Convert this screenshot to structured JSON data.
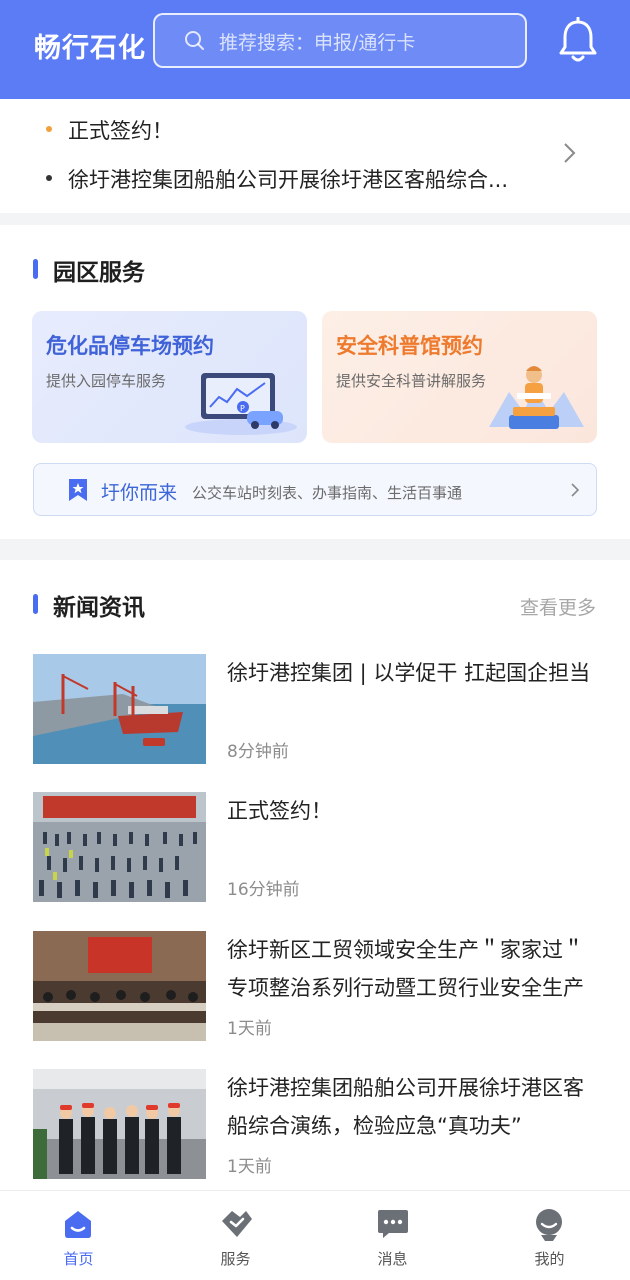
{
  "header": {
    "app_title": "畅行石化",
    "search_placeholder": "推荐搜索：申报/通行卡"
  },
  "ticker": {
    "items": [
      {
        "text": "正式签约！",
        "dot_color": "#f2a03d"
      },
      {
        "text": "徐圩港控集团船舶公司开展徐圩港区客船综合...",
        "dot_color": "#333333"
      }
    ]
  },
  "services": {
    "title": "园区服务",
    "cards": [
      {
        "title": "危化品停车场预约",
        "subtitle": "提供入园停车服务",
        "icon": "parking-dashboard-illustration"
      },
      {
        "title": "安全科普馆预约",
        "subtitle": "提供安全科普讲解服务",
        "icon": "reading-person-illustration"
      }
    ],
    "banner": {
      "title": "圩你而来",
      "desc": "公交车站时刻表、办事指南、生活百事通",
      "icon": "bookmark-star-icon"
    }
  },
  "news": {
    "title": "新闻资讯",
    "more": "查看更多",
    "items": [
      {
        "title": "徐圩港控集团 | 以学促干 扛起国企担当",
        "time": "8分钟前",
        "image": "port-ship-photo"
      },
      {
        "title": "正式签约！",
        "time": "16分钟前",
        "image": "signing-ceremony-crowd-photo"
      },
      {
        "title": "徐圩新区工贸领域安全生产＂家家过＂专项整治系列行动暨工贸行业安全生产",
        "time": "1天前",
        "image": "meeting-room-photo"
      },
      {
        "title": "徐圩港控集团船舶公司开展徐圩港区客船综合演练，检验应急“真功夫”",
        "time": "1天前",
        "image": "group-hardhat-photo"
      }
    ]
  },
  "tabbar": {
    "items": [
      {
        "label": "首页",
        "icon": "home-icon",
        "active": true
      },
      {
        "label": "服务",
        "icon": "service-handshake-icon",
        "active": false
      },
      {
        "label": "消息",
        "icon": "message-icon",
        "active": false
      },
      {
        "label": "我的",
        "icon": "profile-icon",
        "active": false
      }
    ]
  },
  "colors": {
    "brand": "#5b7cf5",
    "accent_blue": "#4a6cf0",
    "accent_orange": "#ee7a2d"
  }
}
